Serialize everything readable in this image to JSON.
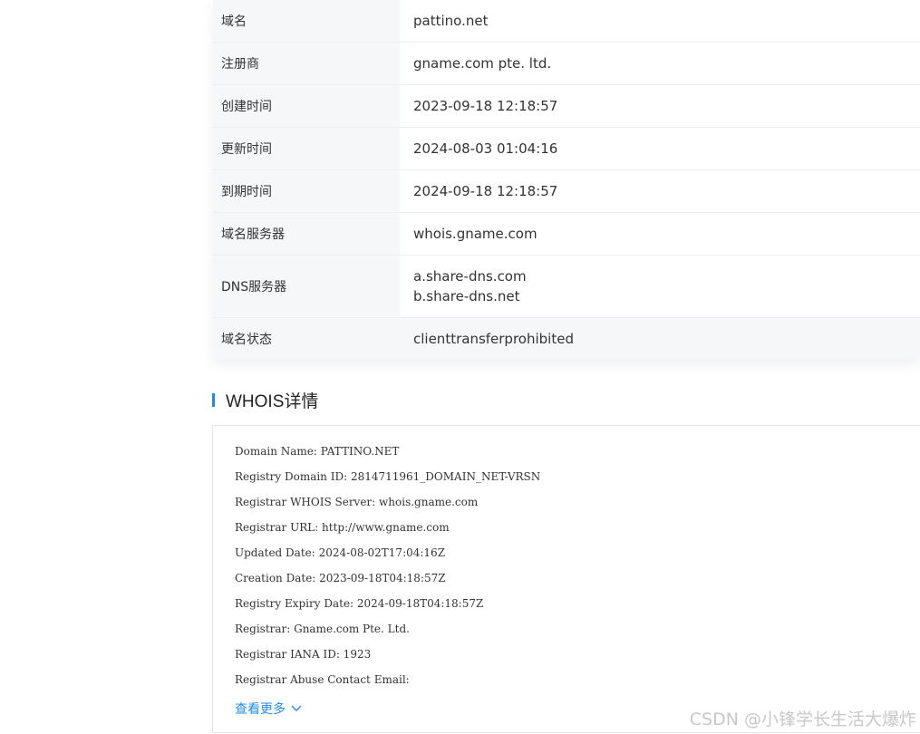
{
  "info_table": {
    "rows": [
      {
        "label": "域名",
        "value": "pattino.net"
      },
      {
        "label": "注册商",
        "value": "gname.com pte. ltd."
      },
      {
        "label": "创建时间",
        "value": "2023-09-18 12:18:57"
      },
      {
        "label": "更新时间",
        "value": "2024-08-03 01:04:16"
      },
      {
        "label": "到期时间",
        "value": "2024-09-18 12:18:57"
      },
      {
        "label": "域名服务器",
        "value": "whois.gname.com"
      },
      {
        "label": "DNS服务器",
        "values": [
          "a.share-dns.com",
          "b.share-dns.net"
        ]
      },
      {
        "label": "域名状态",
        "value": "clienttransferprohibited"
      }
    ]
  },
  "whois_section": {
    "title": "WHOIS详情",
    "accent_color": "#1f8ceb",
    "lines": [
      "Domain Name: PATTINO.NET",
      "Registry Domain ID: 2814711961_DOMAIN_NET-VRSN",
      "Registrar WHOIS Server: whois.gname.com",
      "Registrar URL: http://www.gname.com",
      "Updated Date: 2024-08-02T17:04:16Z",
      "Creation Date: 2023-09-18T04:18:57Z",
      "Registry Expiry Date: 2024-09-18T04:18:57Z",
      "Registrar: Gname.com Pte. Ltd.",
      "Registrar IANA ID: 1923",
      "Registrar Abuse Contact Email:"
    ],
    "more_label": "查看更多",
    "more_icon": "chevron-down-icon"
  },
  "watermark": "CSDN @小锋学长生活大爆炸"
}
